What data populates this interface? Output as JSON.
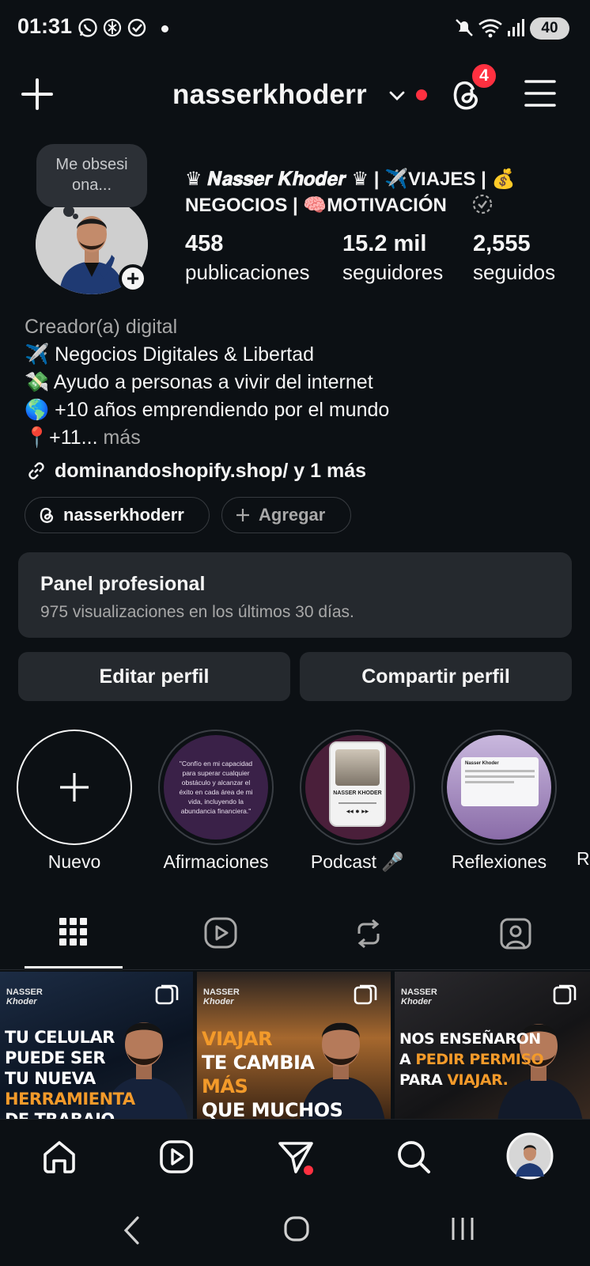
{
  "status_bar": {
    "time": "01:31",
    "battery": "40"
  },
  "header": {
    "username": "nasserkhoderr",
    "threads_badge": "4"
  },
  "profile": {
    "note": "Me obsesi ona...",
    "display_name": "♛ 𝑵𝒂𝒔𝒔𝒆𝒓 𝑲𝒉𝒐𝒅𝒆𝒓 ♛ | ✈️VIAJES | 💰 NEGOCIOS | 🧠MOTIVACIÓN",
    "stats": [
      {
        "value": "458",
        "label": "publicaciones"
      },
      {
        "value": "15.2 mil",
        "label": "seguidores"
      },
      {
        "value": "2,555",
        "label": "seguidos"
      }
    ],
    "category": "Creador(a) digital",
    "bio": [
      "✈️ Negocios Digitales & Libertad",
      "💸 Ayudo a personas a vivir del internet",
      "🌎 +10 años emprendiendo por el mundo",
      "📍+11..."
    ],
    "bio_more": "más",
    "link": "dominandoshopify.shop/ y 1 más",
    "threads_pill": "nasserkhoderr",
    "add_pill": "Agregar"
  },
  "pro_panel": {
    "title": "Panel profesional",
    "subtitle": "975 visualizaciones en los últimos 30 días."
  },
  "actions": {
    "edit": "Editar perfil",
    "share": "Compartir perfil"
  },
  "highlights": [
    {
      "label": "Nuevo"
    },
    {
      "label": "Afirmaciones",
      "quote": "\"Confío en mi capacidad para superar cualquier obstáculo y alcanzar el éxito en cada área de mi vida, incluyendo la abundancia financiera.\""
    },
    {
      "label": "Podcast 🎤",
      "caption": "NASSER KHODER"
    },
    {
      "label": "Reflexiones",
      "caption": "Nasser Khoder"
    },
    {
      "label": "R"
    }
  ],
  "posts": [
    {
      "brand_top": "NASSER",
      "brand_bottom": "Khoder",
      "lines": [
        "TU CELULAR",
        "PUEDE SER",
        "TU NUEVA"
      ],
      "accent": "HERRAMIENTA",
      "cut": "DE TRABAJO"
    },
    {
      "brand_top": "NASSER",
      "brand_bottom": "Khoder",
      "accent_lines": [
        "VIAJAR"
      ],
      "lines": [
        "TE CAMBIA"
      ],
      "accent2": "MÁS",
      "cut": "QUE MUCHOS"
    },
    {
      "brand_top": "NASSER",
      "brand_bottom": "Khoder",
      "line1": "NOS ENSEÑARON",
      "line2_plain": "A ",
      "line2_accent": "PEDIR PERMISO",
      "line3_plain": "PARA ",
      "line3_accent": "VIAJAR."
    }
  ],
  "colors": {
    "background": "#0c1014",
    "surface": "#25292e",
    "badge": "#ff3040",
    "accent_orange": "#f39a2a"
  }
}
